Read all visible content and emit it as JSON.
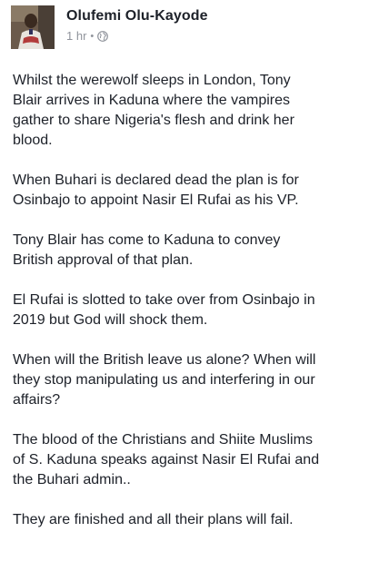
{
  "post": {
    "author": "Olufemi Olu-Kayode",
    "timestamp": "1 hr",
    "separator": "•",
    "privacy_icon": "globe-icon",
    "paragraphs": [
      "Whilst the werewolf sleeps in London, Tony\nBlair arrives in Kaduna where the vampires\ngather to share Nigeria's flesh and drink her\nblood.",
      "When Buhari is declared dead the plan is for\nOsinbajo to appoint Nasir El Rufai as his VP.",
      "Tony Blair has come to Kaduna to convey\nBritish approval of that plan.",
      "El Rufai is slotted to take over from Osinbajo in\n2019 but God will shock them.",
      "When will the British leave us alone? When will\nthey stop manipulating us and interfering in our\naffairs?",
      "The blood of the Christians and Shiite Muslims\nof S. Kaduna speaks against Nasir El Rufai and\nthe Buhari admin..",
      "They are finished and all their plans will fail."
    ]
  },
  "colors": {
    "text": "#1d2129",
    "meta": "#90949c"
  }
}
